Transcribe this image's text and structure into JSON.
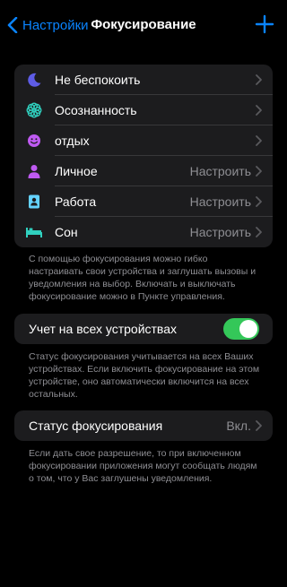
{
  "navbar": {
    "back_label": "Настройки",
    "title": "Фокусирование",
    "add_icon": "plus-icon"
  },
  "modes": [
    {
      "label": "Не беспокоить",
      "value": "",
      "icon": "moon-icon",
      "color": "#5e5ce6"
    },
    {
      "label": "Осознанность",
      "value": "",
      "icon": "flower-icon",
      "color": "#30d0bf"
    },
    {
      "label": "отдых",
      "value": "",
      "icon": "smiley-icon",
      "color": "#bf5af2"
    },
    {
      "label": "Личное",
      "value": "Настроить",
      "icon": "person-icon",
      "color": "#bf5af2"
    },
    {
      "label": "Работа",
      "value": "Настроить",
      "icon": "id-badge-icon",
      "color": "#64d2ff"
    },
    {
      "label": "Сон",
      "value": "Настроить",
      "icon": "bed-icon",
      "color": "#30d0bf"
    }
  ],
  "modes_footer": "С помощью фокусирования можно гибко настраивать свои устройства и заглушать вызовы и уведомления на выбор. Включать и выключать фокусирование можно в Пункте управления.",
  "share_across_devices": {
    "label": "Учет на всех устройствах",
    "enabled": true,
    "footer": "Статус фокусирования учитывается на всех Ваших устройствах. Если включить фокусирование на этом устройстве, оно автоматически включится на всех остальных."
  },
  "focus_status": {
    "label": "Статус фокусирования",
    "value": "Вкл.",
    "footer": "Если дать свое разрешение, то при включенном фокусировании приложения могут сообщать людям о том, что у Вас заглушены уведомления."
  },
  "colors": {
    "accent": "#0a84ff",
    "background": "#000000",
    "cell": "#1c1c1e",
    "secondary_text": "#8e8e93",
    "toggle_on": "#34c759"
  }
}
